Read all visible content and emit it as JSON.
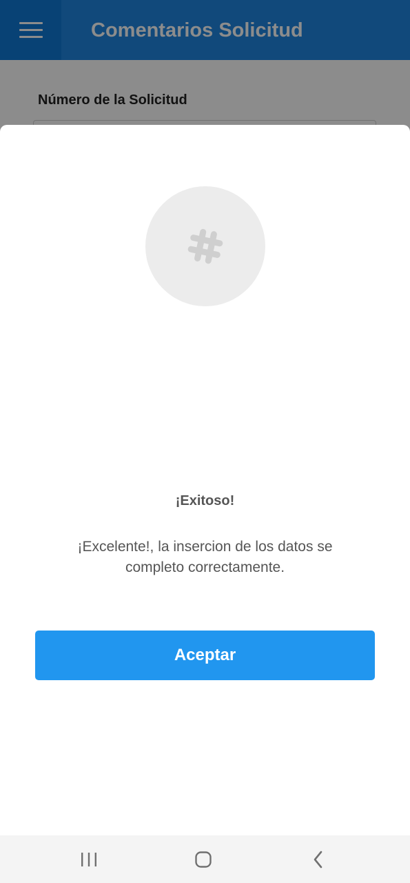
{
  "app": {
    "title": "Comentarios Solicitud",
    "menu_icon": "menu-icon"
  },
  "form": {
    "request_number_label": "Número de la Solicitud",
    "request_number_value": ""
  },
  "dialog": {
    "icon": "hashtag-icon",
    "title": "¡Exitoso!",
    "message": "¡Excelente!, la insercion de los datos se completo correctamente.",
    "accept_label": "Aceptar"
  },
  "system_nav": {
    "recent_icon": "recent-apps-icon",
    "home_icon": "home-icon",
    "back_icon": "back-icon"
  },
  "colors": {
    "app_bar": "#1f86e0",
    "menu_button": "#0f78d6",
    "accept_button": "#2196ef",
    "dialog_text": "#555555"
  }
}
